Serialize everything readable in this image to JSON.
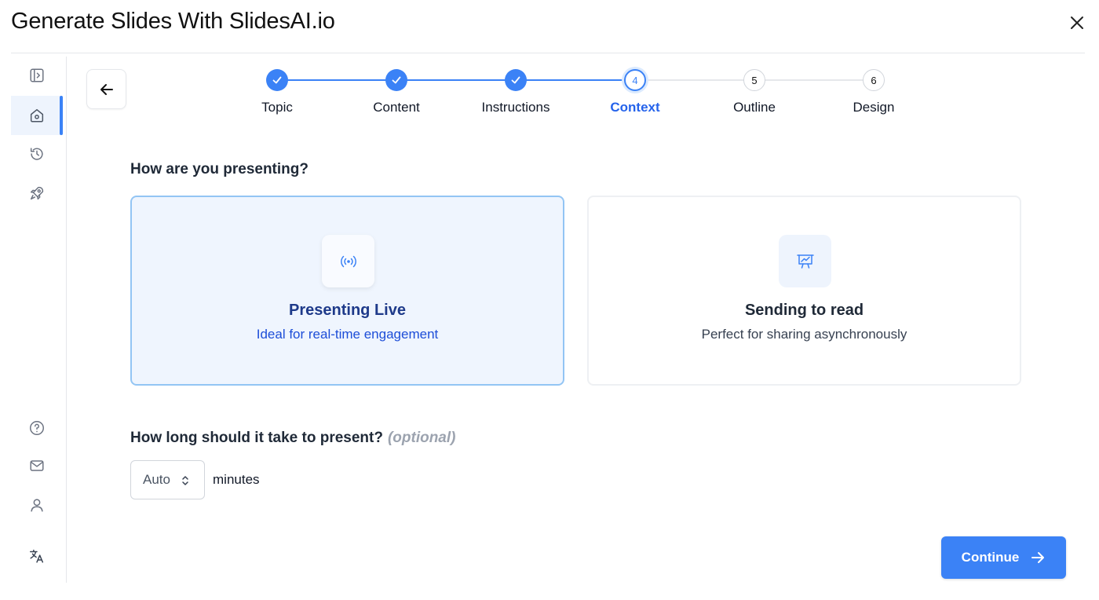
{
  "window": {
    "title": "Generate Slides With SlidesAI.io",
    "close_icon": "close-icon"
  },
  "sidebar": {
    "items": [
      {
        "name": "toggle-sidebar",
        "icon": "panel-toggle-icon"
      },
      {
        "name": "home",
        "icon": "home-icon",
        "active": true
      },
      {
        "name": "history",
        "icon": "history-icon"
      },
      {
        "name": "launch",
        "icon": "rocket-icon"
      },
      {
        "name": "help",
        "icon": "help-circle-icon"
      },
      {
        "name": "mail",
        "icon": "mail-icon"
      },
      {
        "name": "account",
        "icon": "user-icon"
      },
      {
        "name": "language",
        "icon": "translate-icon"
      }
    ]
  },
  "stepper": {
    "steps": [
      {
        "label": "Topic",
        "number": "1",
        "status": "done"
      },
      {
        "label": "Content",
        "number": "2",
        "status": "done"
      },
      {
        "label": "Instructions",
        "number": "3",
        "status": "done"
      },
      {
        "label": "Context",
        "number": "4",
        "status": "current"
      },
      {
        "label": "Outline",
        "number": "5",
        "status": "todo"
      },
      {
        "label": "Design",
        "number": "6",
        "status": "todo"
      }
    ]
  },
  "presenting": {
    "question": "How are you presenting?",
    "options": [
      {
        "title": "Presenting Live",
        "subtitle": "Ideal for real-time engagement",
        "icon": "broadcast-icon",
        "selected": true
      },
      {
        "title": "Sending to read",
        "subtitle": "Perfect for sharing asynchronously",
        "icon": "presentation-chart-icon",
        "selected": false
      }
    ]
  },
  "duration": {
    "question": "How long should it take to present?",
    "optional_label": "(optional)",
    "value": "Auto",
    "unit": "minutes"
  },
  "actions": {
    "continue_label": "Continue"
  },
  "colors": {
    "accent": "#3b82f6",
    "selected_card_bg": "#eff5fe",
    "selected_card_border": "#93c5f4"
  }
}
